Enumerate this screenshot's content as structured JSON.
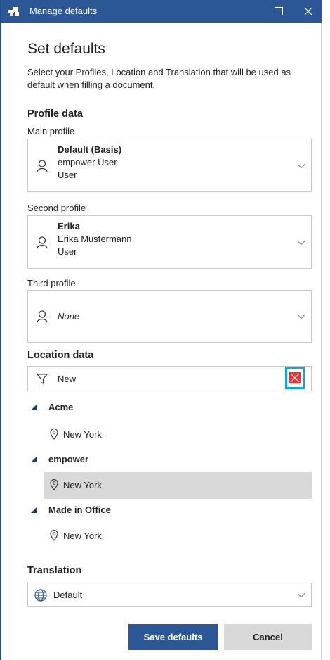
{
  "window": {
    "title": "Manage defaults",
    "maximize_icon": "maximize-icon",
    "close_icon": "close-icon",
    "accent": "#2b5797"
  },
  "header": {
    "title": "Set defaults",
    "description": "Select your Profiles, Location and Translation that will be used as default when filling a document."
  },
  "profile_data": {
    "section_title": "Profile data",
    "main": {
      "label": "Main profile",
      "name": "Default (Basis)",
      "user": "empower User",
      "role": "User"
    },
    "second": {
      "label": "Second profile",
      "name": "Erika",
      "user": "Erika Mustermann",
      "role": "User"
    },
    "third": {
      "label": "Third profile",
      "value": "None"
    }
  },
  "location_data": {
    "section_title": "Location data",
    "filter_value": "New",
    "clear_button_color": "#f23232",
    "highlight_color": "#12a4d9",
    "groups": [
      {
        "name": "Acme",
        "items": [
          "New York"
        ]
      },
      {
        "name": "empower",
        "items": [
          "New York"
        ],
        "selected_item": "New York"
      },
      {
        "name": "Made in Office",
        "items": [
          "New York"
        ]
      }
    ]
  },
  "translation": {
    "section_title": "Translation",
    "value": "Default"
  },
  "buttons": {
    "save": "Save defaults",
    "cancel": "Cancel"
  }
}
